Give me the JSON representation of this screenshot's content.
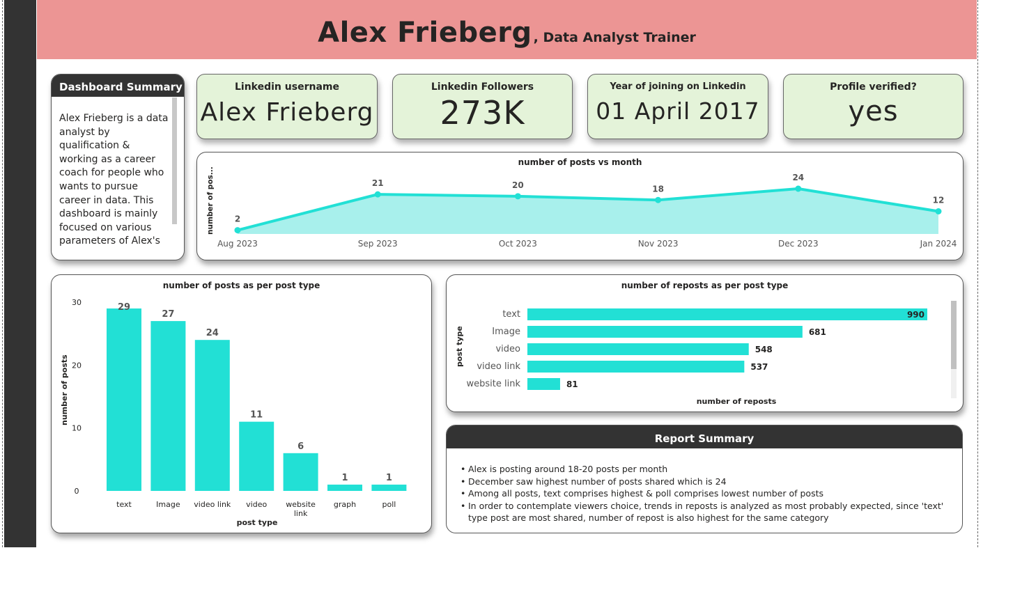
{
  "header": {
    "name": "Alex Frieberg",
    "role": ", Data Analyst Trainer"
  },
  "summary": {
    "title": "Dashboard Summary",
    "text": "Alex Frieberg is a data analyst by qualification & working as a career coach for people who wants to pursue career in data. This dashboard is mainly focused on various parameters of Alex's Linkedin profile, where"
  },
  "cards": [
    {
      "label": "Linkedin username",
      "value": "Alex Frieberg"
    },
    {
      "label": "Linkedin Followers",
      "value": "273K"
    },
    {
      "label": "Year of joining on Linkedin",
      "value": "01 April 2017"
    },
    {
      "label": "Profile verified?",
      "value": "yes"
    }
  ],
  "report": {
    "title": "Report Summary",
    "points": [
      "Alex is posting around 18-20 posts per month",
      "December saw highest number of posts shared which is 24",
      "Among all posts, text comprises highest & poll comprises lowest number of posts",
      "In order to contemplate viewers choice, trends in reposts is analyzed as most probably expected, since 'text' type post are most shared, number of repost is also highest for the same category"
    ]
  },
  "colors": {
    "accent": "#22e0d5",
    "area_fill": "#a8f0ec",
    "header": "#ec9594",
    "card": "#e4f3d9",
    "dark": "#333333"
  },
  "chart_data": [
    {
      "type": "area",
      "title": "number of posts vs month",
      "xlabel": "",
      "ylabel": "number of pos...",
      "x": [
        "Aug 2023",
        "Sep 2023",
        "Oct 2023",
        "Nov 2023",
        "Dec 2023",
        "Jan 2024"
      ],
      "values": [
        2,
        21,
        20,
        18,
        24,
        12
      ],
      "ylim": [
        0,
        24
      ]
    },
    {
      "type": "bar",
      "title": "number of posts as per post type",
      "xlabel": "post type",
      "ylabel": "number of posts",
      "categories": [
        "text",
        "Image",
        "video link",
        "video",
        "website link",
        "graph",
        "poll"
      ],
      "values": [
        29,
        27,
        24,
        11,
        6,
        1,
        1
      ],
      "ylim": [
        0,
        30
      ],
      "yticks": [
        0,
        10,
        20,
        30
      ]
    },
    {
      "type": "bar",
      "orientation": "horizontal",
      "title": "number of reposts as per post type",
      "xlabel": "number of reposts",
      "ylabel": "post type",
      "categories": [
        "text",
        "Image",
        "video",
        "video link",
        "website link"
      ],
      "values": [
        990,
        681,
        548,
        537,
        81
      ]
    }
  ]
}
